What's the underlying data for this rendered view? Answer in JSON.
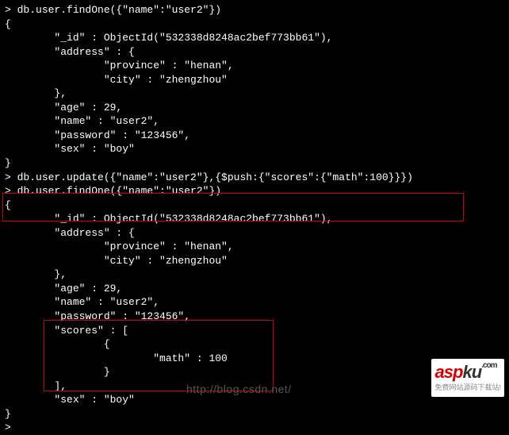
{
  "query1": {
    "cmd": "db.user.findOne({\"name\":\"user2\"})",
    "result": {
      "open": "{",
      "id_line": "        \"_id\" : ObjectId(\"532338d8248ac2bef773bb61\"),",
      "addr_open": "        \"address\" : {",
      "province": "                \"province\" : \"henan\",",
      "city": "                \"city\" : \"zhengzhou\"",
      "addr_close": "        },",
      "age": "        \"age\" : 29,",
      "name": "        \"name\" : \"user2\",",
      "password": "        \"password\" : \"123456\",",
      "sex": "        \"sex\" : \"boy\"",
      "close": "}"
    }
  },
  "update_cmd": "db.user.update({\"name\":\"user2\"},{$push:{\"scores\":{\"math\":100}}})",
  "query2": {
    "cmd": "db.user.findOne({\"name\":\"user2\"})",
    "result": {
      "open": "{",
      "id_line": "        \"_id\" : ObjectId(\"532338d8248ac2bef773bb61\"),",
      "addr_open": "        \"address\" : {",
      "province": "                \"province\" : \"henan\",",
      "city": "                \"city\" : \"zhengzhou\"",
      "addr_close": "        },",
      "age": "        \"age\" : 29,",
      "name": "        \"name\" : \"user2\",",
      "password": "        \"password\" : \"123456\",",
      "scores_open": "        \"scores\" : [",
      "scores_obj_open": "                {",
      "scores_math": "                        \"math\" : 100",
      "scores_obj_close": "                }",
      "scores_close": "        ],",
      "sex": "        \"sex\" : \"boy\"",
      "close": "}"
    }
  },
  "prompt_last": ">",
  "watermark": {
    "url": "http://blog.csdn.net/",
    "brand_a": "a",
    "brand_s": "s",
    "brand_p": "p",
    "brand_k": "k",
    "brand_u": "u",
    "dot_com": ".com",
    "tagline": "免费网站源码下载站!"
  }
}
